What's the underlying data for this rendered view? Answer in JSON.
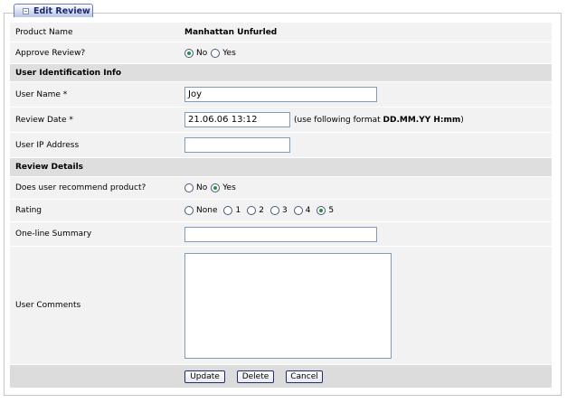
{
  "tab": {
    "title": "Edit Review",
    "icon": "collapse-icon"
  },
  "product": {
    "label": "Product Name",
    "value": "Manhattan Unfurled"
  },
  "approve": {
    "label": "Approve Review?",
    "options": [
      "No",
      "Yes"
    ],
    "selected": "No"
  },
  "sections": {
    "user_info": "User Identification Info",
    "review_details": "Review Details"
  },
  "user_name": {
    "label": "User Name *",
    "value": "Joy"
  },
  "review_date": {
    "label": "Review Date *",
    "value": "21.06.06 13:12",
    "hint_prefix": "(use following format ",
    "hint_format": "DD.MM.YY H:mm",
    "hint_suffix": ")"
  },
  "user_ip": {
    "label": "User IP Address",
    "value": ""
  },
  "recommend": {
    "label": "Does user recommend product?",
    "options": [
      "No",
      "Yes"
    ],
    "selected": "Yes"
  },
  "rating": {
    "label": "Rating",
    "options": [
      "None",
      "1",
      "2",
      "3",
      "4",
      "5"
    ],
    "selected": "5"
  },
  "summary": {
    "label": "One-line Summary",
    "value": ""
  },
  "comments": {
    "label": "User Comments",
    "value": ""
  },
  "buttons": {
    "update": "Update",
    "delete": "Delete",
    "cancel": "Cancel"
  },
  "colors": {
    "tab_border": "#6b7cc4",
    "row_bg": "#f2f2f2",
    "section_bg": "#dedede",
    "radio_checked": "#27913a"
  }
}
